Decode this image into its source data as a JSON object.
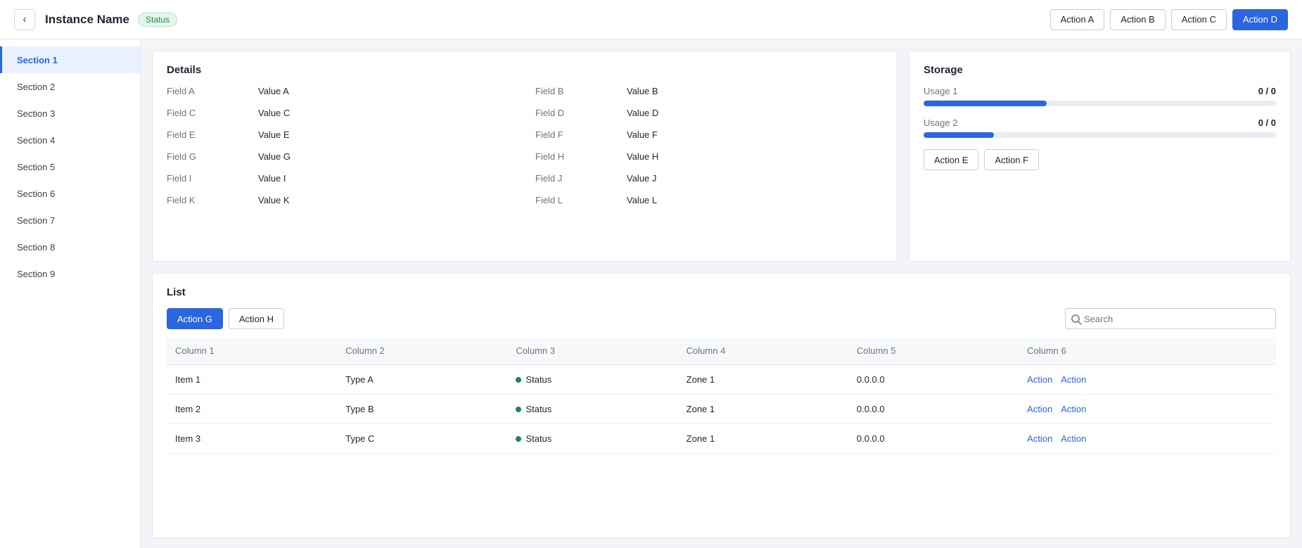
{
  "topbar": {
    "back_label": "‹",
    "title": "Instance Name",
    "status": "Status",
    "actions": [
      "Action A",
      "Action B",
      "Action C",
      "Action D"
    ]
  },
  "sidebar": {
    "items": [
      "Section 1",
      "Section 2",
      "Section 3",
      "Section 4",
      "Section 5",
      "Section 6",
      "Section 7",
      "Section 8",
      "Section 9"
    ]
  },
  "info": {
    "title": "Details",
    "fields": [
      {
        "label": "Field A",
        "value": "Value A"
      },
      {
        "label": "Field B",
        "value": "Value B"
      },
      {
        "label": "Field C",
        "value": "Value C"
      },
      {
        "label": "Field D",
        "value": "Value D"
      },
      {
        "label": "Field E",
        "value": "Value E"
      },
      {
        "label": "Field F",
        "value": "Value F"
      },
      {
        "label": "Field G",
        "value": "Value G"
      },
      {
        "label": "Field H",
        "value": "Value H"
      },
      {
        "label": "Field I",
        "value": "Value I"
      },
      {
        "label": "Field J",
        "value": "Value J"
      },
      {
        "label": "Field K",
        "value": "Value K"
      },
      {
        "label": "Field L",
        "value": "Value L"
      }
    ]
  },
  "storage": {
    "title": "Storage",
    "rows": [
      {
        "label": "Usage 1",
        "value": "0 / 0",
        "fraction": 0.35
      },
      {
        "label": "Usage 2",
        "value": "0 / 0",
        "fraction": 0.2
      }
    ],
    "actions": [
      "Action E",
      "Action F"
    ]
  },
  "nodes": {
    "title": "List",
    "toolbar": [
      "Action G",
      "Action H"
    ],
    "search_placeholder": "Search",
    "columns": [
      "Column 1",
      "Column 2",
      "Column 3",
      "Column 4",
      "Column 5",
      "Column 6"
    ],
    "rows": [
      {
        "c1": "Item 1",
        "c2": "Type A",
        "c3": "Status",
        "c4": "Zone 1",
        "c5": "0.0.0.0",
        "a1": "Action",
        "a2": "Action"
      },
      {
        "c1": "Item 2",
        "c2": "Type B",
        "c3": "Status",
        "c4": "Zone 1",
        "c5": "0.0.0.0",
        "a1": "Action",
        "a2": "Action"
      },
      {
        "c1": "Item 3",
        "c2": "Type C",
        "c3": "Status",
        "c4": "Zone 1",
        "c5": "0.0.0.0",
        "a1": "Action",
        "a2": "Action"
      }
    ]
  }
}
